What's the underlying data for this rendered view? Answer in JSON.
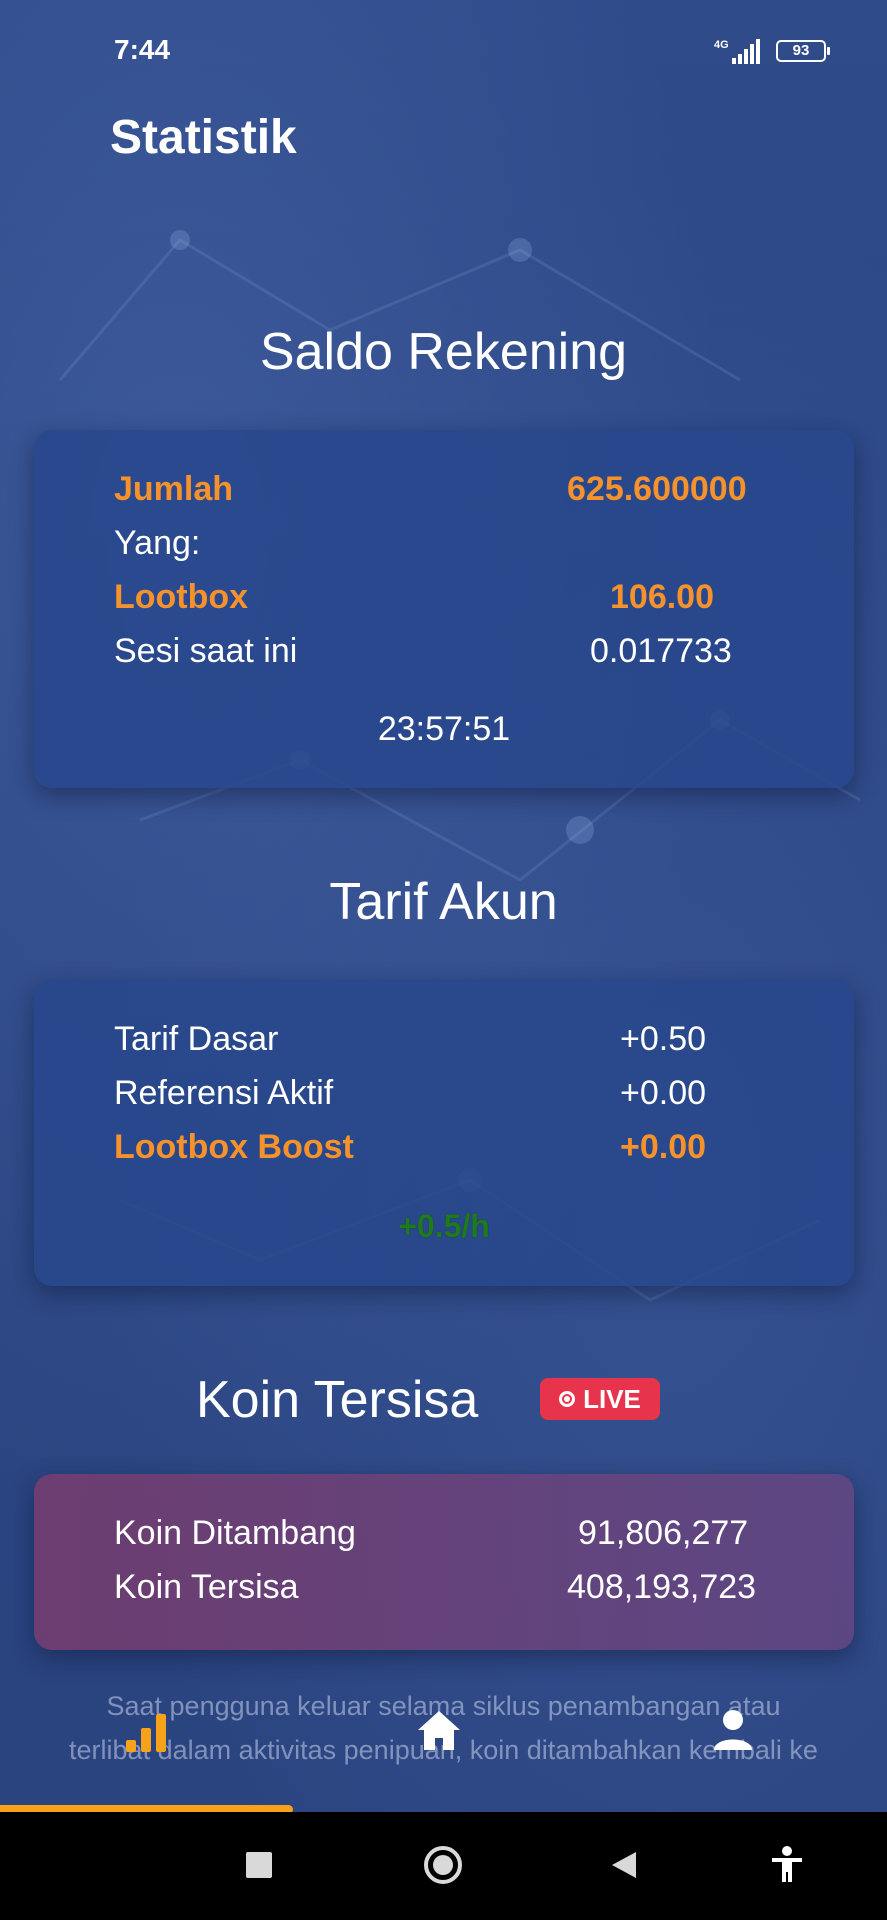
{
  "status_bar": {
    "time": "7:44",
    "network": "4G",
    "battery": "93"
  },
  "page": {
    "title": "Statistik"
  },
  "saldo": {
    "title": "Saldo Rekening",
    "rows": [
      {
        "label": "Jumlah",
        "value": "625.600000"
      },
      {
        "label": "Yang:",
        "value": ""
      },
      {
        "label": "Lootbox",
        "value": "106.00"
      },
      {
        "label": "Sesi saat ini",
        "value": "0.017733"
      }
    ],
    "timer": "23:57:51"
  },
  "tarif": {
    "title": "Tarif Akun",
    "rows": [
      {
        "label": "Tarif Dasar",
        "value": "+0.50"
      },
      {
        "label": "Referensi Aktif",
        "value": "+0.00"
      },
      {
        "label": "Lootbox Boost",
        "value": "+0.00"
      }
    ],
    "total_rate": "+0.5/h"
  },
  "koin": {
    "title": "Koin Tersisa",
    "live_label": "LIVE",
    "rows": [
      {
        "label": "Koin Ditambang",
        "value": "91,806,277"
      },
      {
        "label": "Koin Tersisa",
        "value": "408,193,723"
      }
    ]
  },
  "footnote": {
    "line1": "Saat pengguna keluar selama siklus penambangan atau",
    "line2": "terlibat dalam aktivitas penipuan, koin ditambahkan kembali ke"
  },
  "nav": {
    "items": [
      {
        "icon": "bar-chart-icon",
        "active": true
      },
      {
        "icon": "home-icon",
        "active": false
      },
      {
        "icon": "user-icon",
        "active": false
      }
    ]
  },
  "colors": {
    "accent": "#f5922b",
    "live": "#e7334b",
    "rate": "#1f7a1f",
    "nav_indicator": "#f7a21b"
  }
}
